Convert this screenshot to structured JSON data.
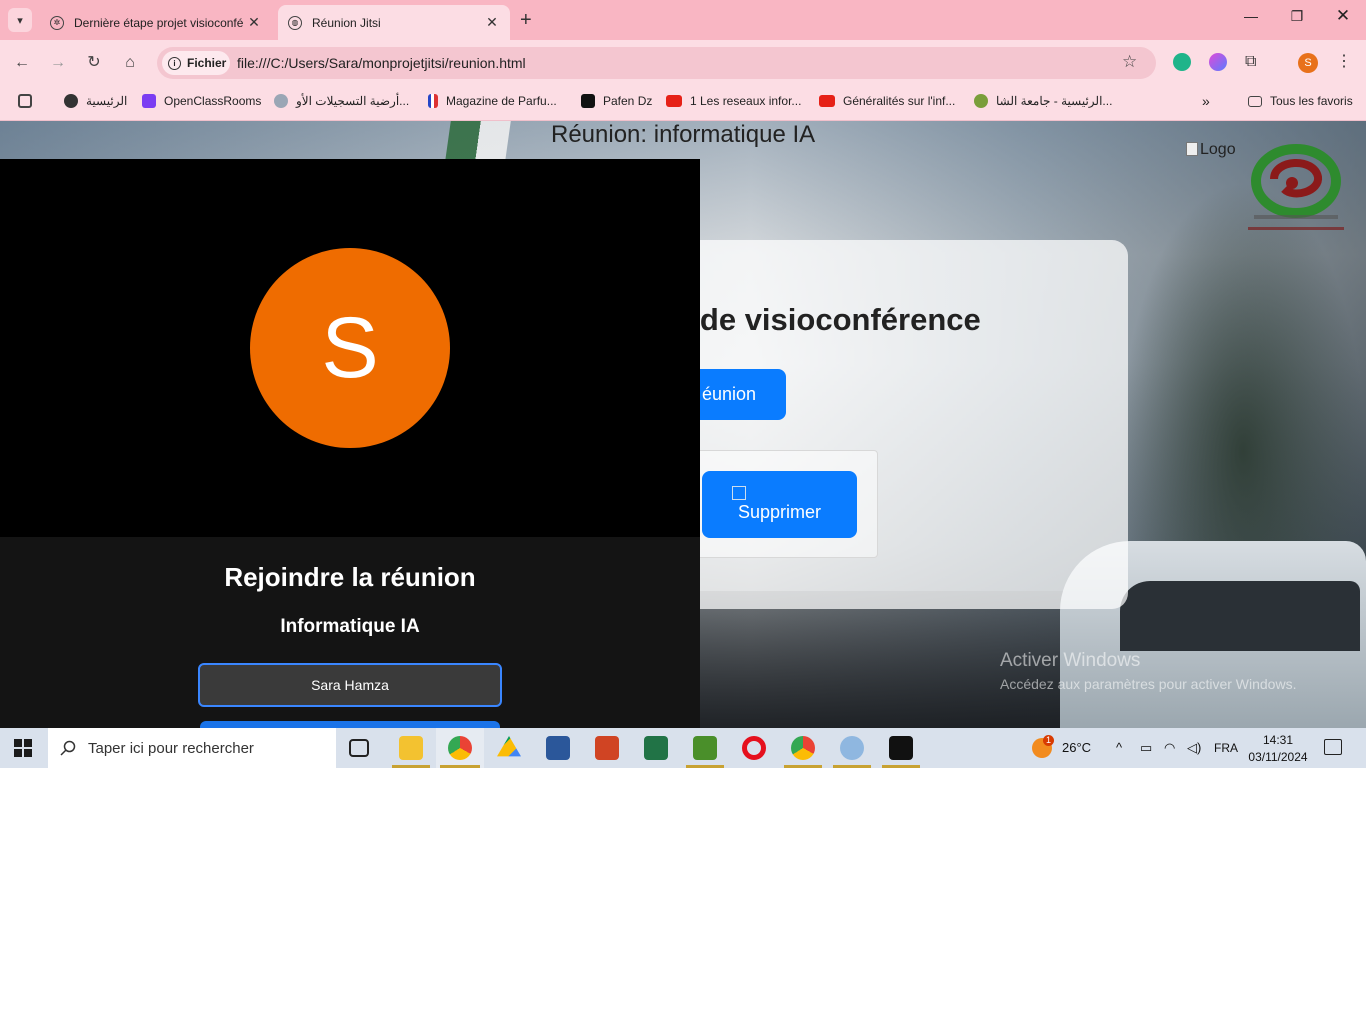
{
  "browser": {
    "tabs": [
      {
        "title": "Dernière étape projet visioconfé",
        "active": false
      },
      {
        "title": "Réunion Jitsi",
        "active": true
      }
    ],
    "address": {
      "chip_label": "Fichier",
      "url": "file:///C:/Users/Sara/monprojetjitsi/reunion.html"
    },
    "profile_initial": "S",
    "bookmarks": [
      {
        "label": "الرئيسية",
        "icon": "globe-icon"
      },
      {
        "label": "OpenClassRooms",
        "icon": "openclassrooms-icon"
      },
      {
        "label": "أرضية التسجيلات الأو...",
        "icon": "site-icon"
      },
      {
        "label": "Magazine de Parfu...",
        "icon": "magazine-icon"
      },
      {
        "label": "Pafen Dz",
        "icon": "pafen-icon"
      },
      {
        "label": "1 Les reseaux infor...",
        "icon": "youtube-icon"
      },
      {
        "label": "Généralités sur l'inf...",
        "icon": "youtube-icon"
      },
      {
        "label": "الرئيسية - جامعة الشا...",
        "icon": "university-icon"
      }
    ],
    "all_bookmarks_label": "Tous les favoris"
  },
  "page": {
    "meeting_title": "Réunion: informatique IA",
    "logo_alt": "Logo",
    "card": {
      "heading": "cation de visioconférence",
      "join_button": "éunion",
      "delete_button": "Supprimer"
    },
    "overlay": {
      "avatar_initial": "S",
      "title": "Rejoindre la réunion",
      "subtitle": "Informatique IA",
      "name_value": "Sara Hamza"
    },
    "watermark": {
      "line1": "Activer Windows",
      "line2": "Accédez aux paramètres pour activer Windows."
    }
  },
  "taskbar": {
    "search_placeholder": "Taper ici pour rechercher",
    "weather": "26°C",
    "weather_badge": "1",
    "language": "FRA",
    "time": "14:31",
    "date": "03/11/2024"
  },
  "colors": {
    "tabbar": "#f9b6c3",
    "toolbar": "#fcdde4",
    "accent_blue": "#0a7cff",
    "avatar_orange": "#ef6c00"
  }
}
